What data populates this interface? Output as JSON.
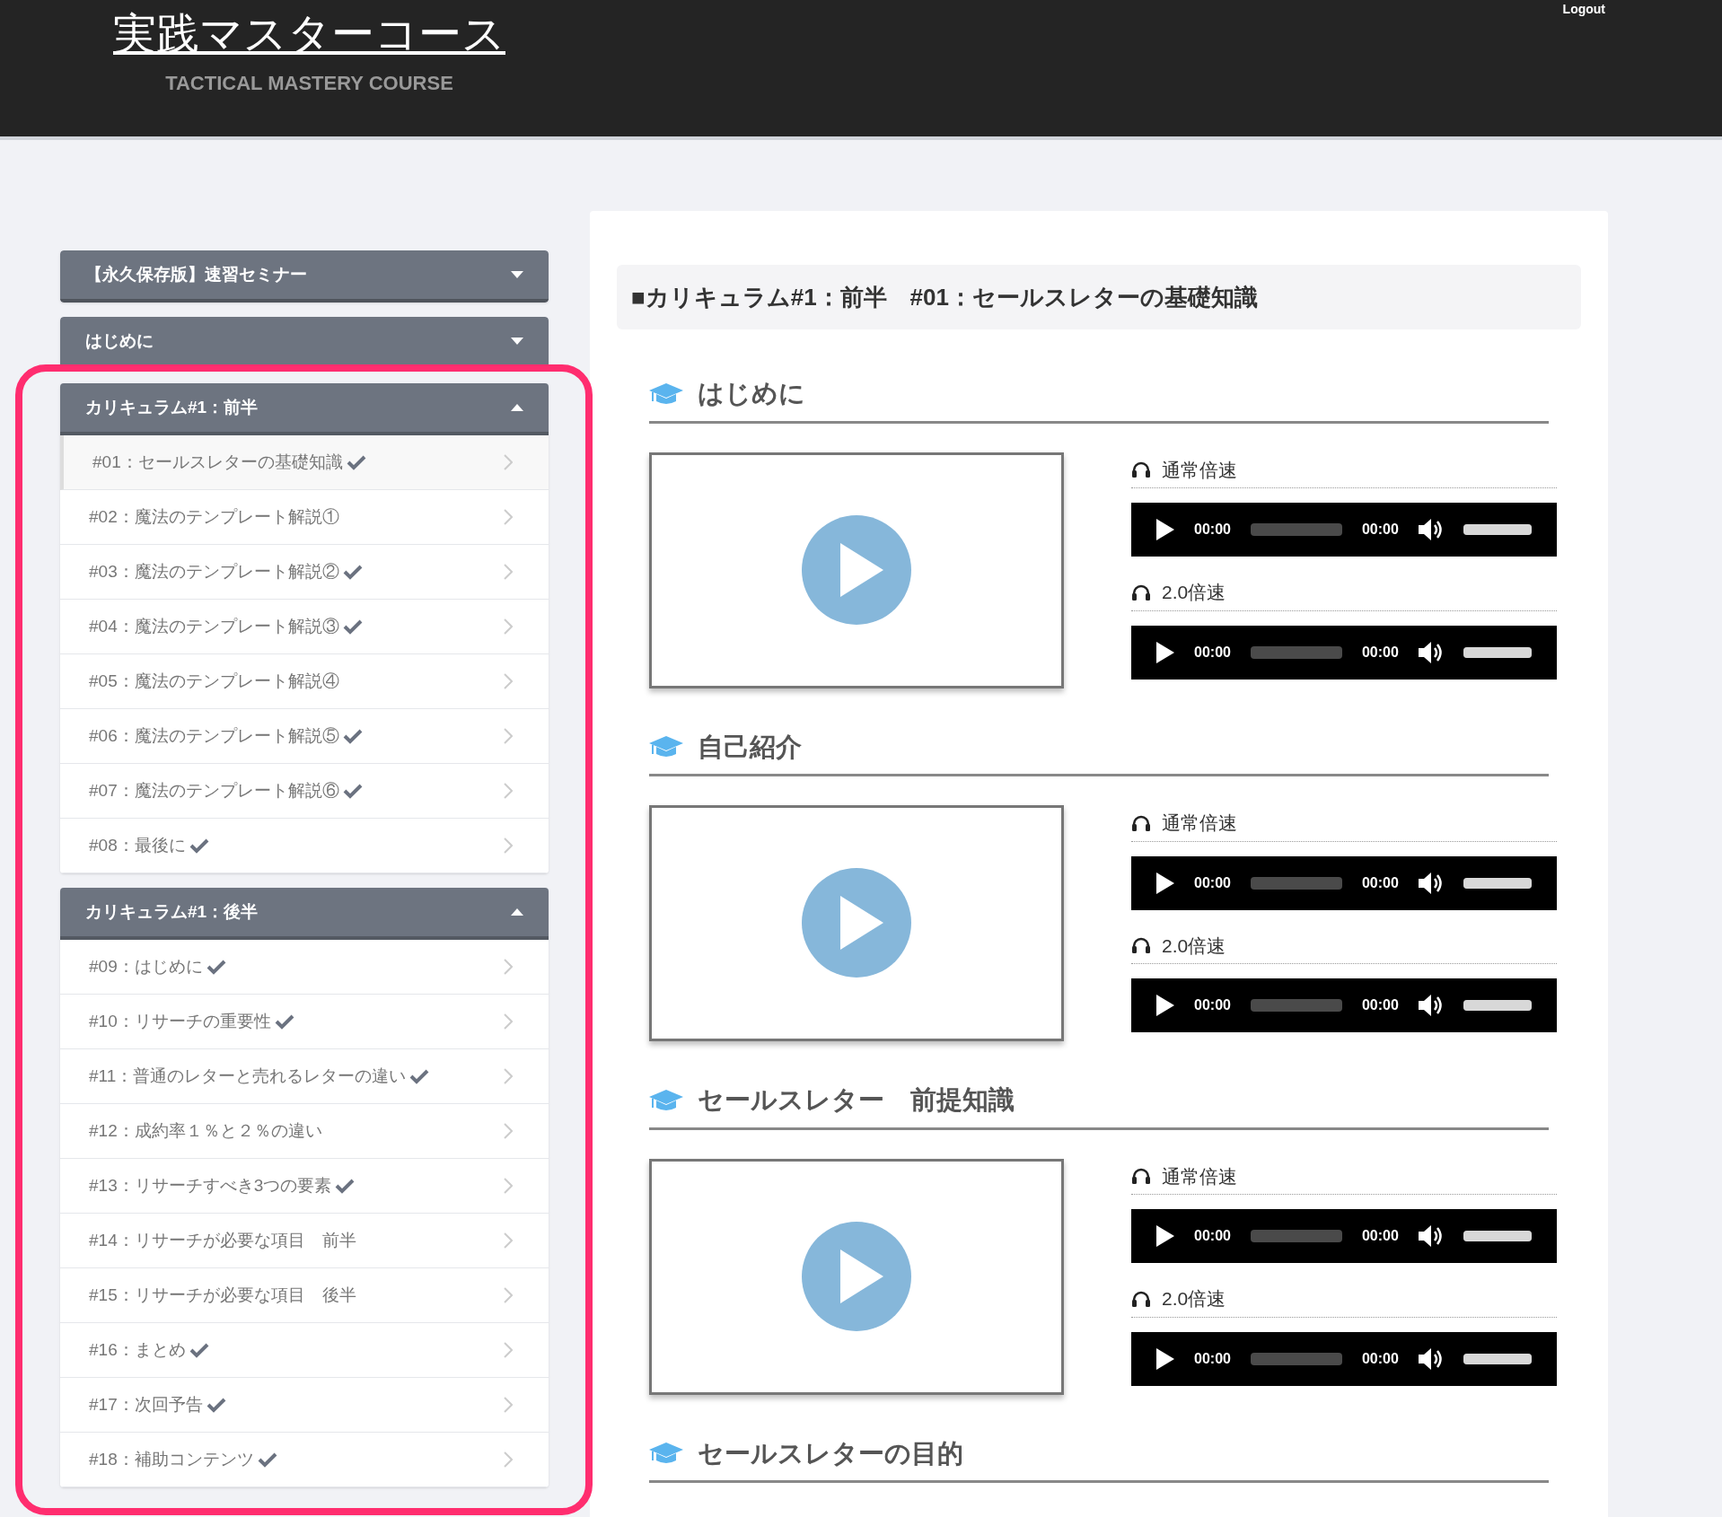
{
  "header": {
    "title": "実践マスターコース",
    "subtitle": "TACTICAL MASTERY COURSE",
    "logout": "Logout"
  },
  "sidebar": {
    "groups": [
      {
        "title": "【永久保存版】速習セミナー",
        "expanded": false
      },
      {
        "title": "はじめに",
        "expanded": false
      },
      {
        "title": "カリキュラム#1：前半",
        "expanded": true,
        "items": [
          {
            "label": "#01：セールスレターの基礎知識",
            "done": true,
            "selected": true
          },
          {
            "label": "#02：魔法のテンプレート解説①",
            "done": false,
            "selected": false
          },
          {
            "label": "#03：魔法のテンプレート解説②",
            "done": true,
            "selected": false
          },
          {
            "label": "#04：魔法のテンプレート解説③",
            "done": true,
            "selected": false
          },
          {
            "label": "#05：魔法のテンプレート解説④",
            "done": false,
            "selected": false
          },
          {
            "label": "#06：魔法のテンプレート解説⑤",
            "done": true,
            "selected": false
          },
          {
            "label": "#07：魔法のテンプレート解説⑥",
            "done": true,
            "selected": false
          },
          {
            "label": "#08：最後に",
            "done": true,
            "selected": false
          }
        ]
      },
      {
        "title": "カリキュラム#1：後半",
        "expanded": true,
        "items": [
          {
            "label": "#09：はじめに",
            "done": true,
            "selected": false
          },
          {
            "label": "#10：リサーチの重要性",
            "done": true,
            "selected": false
          },
          {
            "label": "#11：普通のレターと売れるレターの違い",
            "done": true,
            "selected": false
          },
          {
            "label": "#12：成約率１％と２％の違い",
            "done": false,
            "selected": false
          },
          {
            "label": "#13：リサーチすべき3つの要素",
            "done": true,
            "selected": false
          },
          {
            "label": "#14：リサーチが必要な項目　前半",
            "done": false,
            "selected": false
          },
          {
            "label": "#15：リサーチが必要な項目　後半",
            "done": false,
            "selected": false
          },
          {
            "label": "#16：まとめ",
            "done": true,
            "selected": false
          },
          {
            "label": "#17：次回予告",
            "done": true,
            "selected": false
          },
          {
            "label": "#18：補助コンテンツ",
            "done": true,
            "selected": false
          }
        ]
      }
    ]
  },
  "content": {
    "title": "■カリキュラム#1：前半　#01：セールスレターの基礎知識",
    "sections": [
      {
        "heading": "はじめに",
        "players": [
          {
            "label": "通常倍速",
            "current": "00:00",
            "duration": "00:00",
            "level": 1
          },
          {
            "label": "2.0倍速",
            "current": "00:00",
            "duration": "00:00",
            "level": 1
          }
        ]
      },
      {
        "heading": "自己紹介",
        "players": [
          {
            "label": "通常倍速",
            "current": "00:00",
            "duration": "00:00",
            "level": 1
          },
          {
            "label": "2.0倍速",
            "current": "00:00",
            "duration": "00:00",
            "level": 1
          }
        ]
      },
      {
        "heading": "セールスレター　前提知識",
        "players": [
          {
            "label": "通常倍速",
            "current": "00:00",
            "duration": "00:00",
            "level": 1
          },
          {
            "label": "2.0倍速",
            "current": "00:00",
            "duration": "00:00",
            "level": 1
          }
        ]
      },
      {
        "heading": "セールスレターの目的"
      }
    ]
  }
}
